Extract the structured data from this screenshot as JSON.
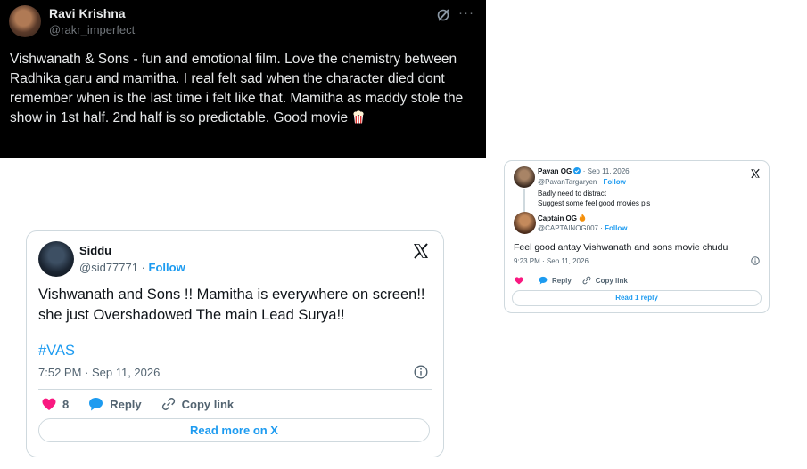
{
  "dark_tweet": {
    "name": "Ravi Krishna",
    "handle": "@rakr_imperfect",
    "more_label": "···",
    "text": "Vishwanath & Sons - fun and emotional film. Love the chemistry between Radhika garu and mamitha. I real felt sad when the character died dont remember when is the last time i felt like that. Mamitha as maddy stole the show in 1st half. 2nd half is so predictable. Good movie",
    "emoji": "popcorn-icon",
    "bg_color": "#000000"
  },
  "main_tweet": {
    "name": "Siddu",
    "handle": "@sid77771",
    "separator": " · ",
    "follow_label": "Follow",
    "text": "Vishwanath and Sons !! Mamitha is everywhere on screen!! she just Overshadowed The main Lead Surya!!",
    "hashtag": "#VAS",
    "timestamp": "7:52 PM · Sep 11, 2026",
    "like_count": "8",
    "reply_label": "Reply",
    "copy_label": "Copy link",
    "read_more_label": "Read more on X",
    "accent": "#1d9bf0"
  },
  "reply_tweet": {
    "parent": {
      "name": "Pavan OG",
      "date": "· Sep 11, 2026",
      "handle": "@PavanTargaryen",
      "separator": " · ",
      "follow_label": "Follow",
      "line1": "Badly need to distract",
      "line2": "Suggest some feel good movies pls"
    },
    "author": {
      "name": "Captain OG",
      "handle": "@CAPTAINOG007",
      "separator": " · ",
      "follow_label": "Follow"
    },
    "text": "Feel good antay Vishwanath and sons movie chudu",
    "timestamp": "9:23 PM · Sep 11, 2026",
    "reply_label": "Reply",
    "copy_label": "Copy link",
    "read_replies_label": "Read 1 reply"
  }
}
